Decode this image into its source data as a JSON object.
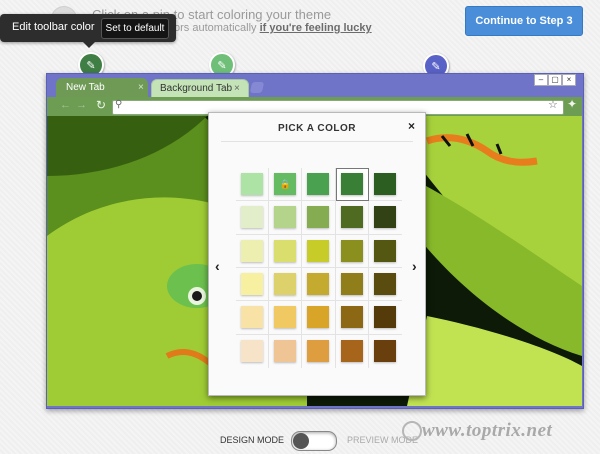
{
  "header": {
    "hint_line1": "Click on a pin to start coloring your theme",
    "hint_line2_prefix": "ors automatically ",
    "hint_line2_link": "if you're feeling lucky",
    "continue_label": "Continue to Step 3"
  },
  "tooltip": {
    "label": "Edit toolbar color",
    "button": "Set to default"
  },
  "pins": {
    "toolbar_color": "#3f7e44",
    "background_tab_color": "#6fbf79",
    "frame_color": "#5962c6"
  },
  "browser": {
    "tabs": [
      {
        "label": "New Tab",
        "close": "×"
      },
      {
        "label": "Background Tab",
        "close": "×"
      }
    ],
    "window_controls": [
      "–",
      "▢",
      "×"
    ],
    "frame_color": "#6f74c8",
    "toolbar_color": "#6c9d52"
  },
  "picker": {
    "title": "PICK A COLOR",
    "close": "×",
    "prev": "‹",
    "next": "›",
    "selected": {
      "row": 0,
      "col": 3
    },
    "locked": {
      "row": 0,
      "col": 1
    },
    "swatches": [
      [
        "#aee3a6",
        "#65bb62",
        "#4aa14f",
        "#3a7f36",
        "#2d5e21"
      ],
      [
        "#e2edca",
        "#b4d48b",
        "#86ac51",
        "#4f6b22",
        "#334214"
      ],
      [
        "#ecefb0",
        "#d9de6c",
        "#c7cc28",
        "#8a8f1d",
        "#545711"
      ],
      [
        "#f8f0a1",
        "#ddd16b",
        "#c4ab2f",
        "#8f7e19",
        "#5a4c0e"
      ],
      [
        "#f9e2a5",
        "#f0c963",
        "#d9a528",
        "#8c6815",
        "#563b0a"
      ],
      [
        "#f6e3c8",
        "#efc596",
        "#de9d3f",
        "#a7651b",
        "#6a3f0e"
      ]
    ]
  },
  "footer": {
    "design_mode": "DESIGN MODE",
    "preview_mode": "PREVIEW MODE",
    "watermark": "www.toptrix.net"
  }
}
